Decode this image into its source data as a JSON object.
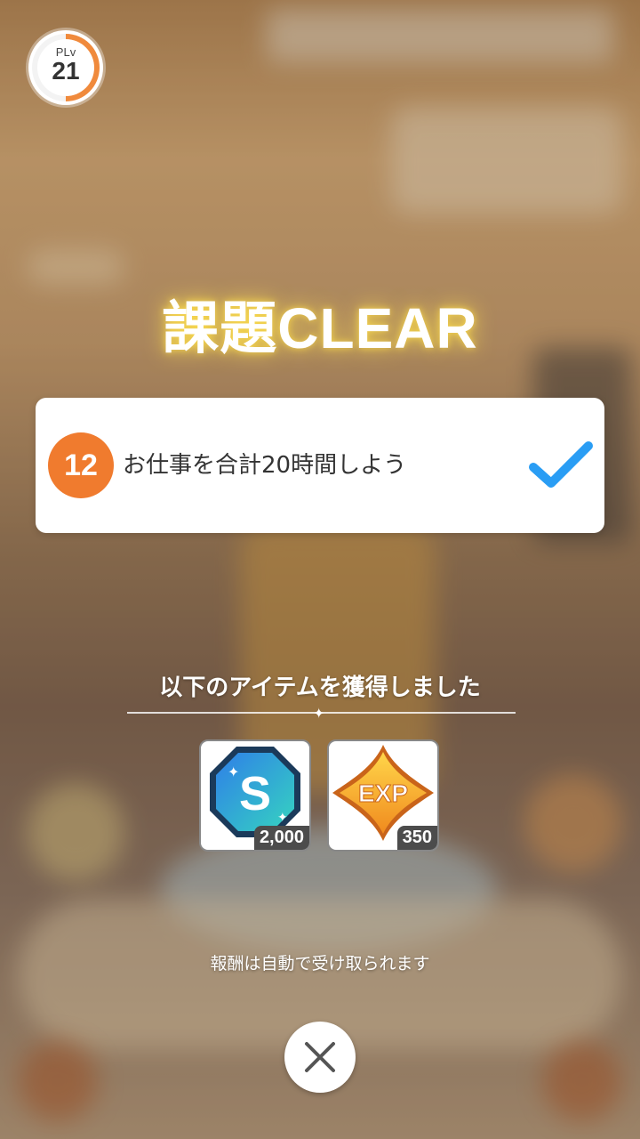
{
  "player_level": {
    "label": "PLv",
    "value": "21"
  },
  "title": "課題CLEAR",
  "task": {
    "number": "12",
    "text": "お仕事を合計20時間しよう"
  },
  "rewards": {
    "label": "以下のアイテムを獲得しました",
    "items": [
      {
        "icon": "s-currency-icon",
        "symbol": "S",
        "quantity": "2,000"
      },
      {
        "icon": "exp-icon",
        "symbol": "EXP",
        "quantity": "350"
      }
    ]
  },
  "auto_receive_note": "報酬は自動で受け取られます",
  "colors": {
    "accent": "#f07b2e",
    "check": "#2a9df4"
  }
}
